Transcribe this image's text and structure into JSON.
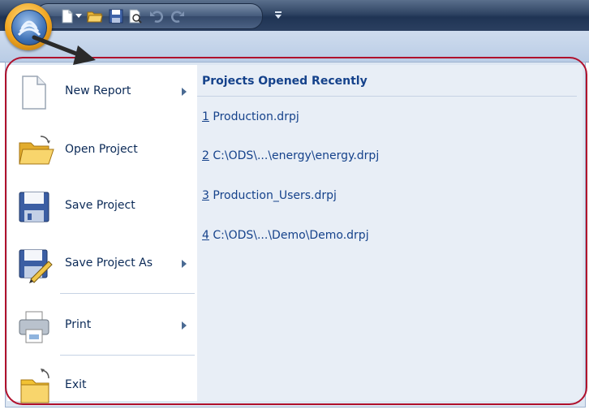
{
  "top_text": "(",
  "qat": {
    "items": [
      {
        "icon": "new-document-icon"
      },
      {
        "icon": "dropdown-arrow-icon"
      },
      {
        "icon": "open-folder-icon"
      },
      {
        "icon": "save-disk-icon"
      },
      {
        "icon": "print-preview-icon"
      },
      {
        "icon": "undo-icon"
      },
      {
        "icon": "redo-icon"
      }
    ],
    "customize_icon": "customize-qat-icon"
  },
  "menu": {
    "items": [
      {
        "label": "New Report",
        "icon": "new-report-icon",
        "has_submenu": true
      },
      {
        "label": "Open Project",
        "icon": "open-project-icon",
        "has_submenu": false
      },
      {
        "label": "Save Project",
        "icon": "save-project-icon",
        "has_submenu": false
      },
      {
        "label": "Save Project As",
        "icon": "save-project-as-icon",
        "has_submenu": true
      },
      {
        "label": "Print",
        "icon": "print-icon",
        "has_submenu": true
      },
      {
        "label": "Exit",
        "icon": "exit-icon",
        "has_submenu": false
      }
    ]
  },
  "recent": {
    "title": "Projects Opened Recently",
    "items": [
      {
        "num": "1",
        "name": " Production.drpj"
      },
      {
        "num": "2",
        "name": " C:\\ODS\\...\\energy\\energy.drpj"
      },
      {
        "num": "3",
        "name": " Production_Users.drpj"
      },
      {
        "num": "4",
        "name": " C:\\ODS\\...\\Demo\\Demo.drpj"
      }
    ]
  },
  "colors": {
    "accent": "#15428b",
    "highlight_outline": "#b0102c"
  }
}
